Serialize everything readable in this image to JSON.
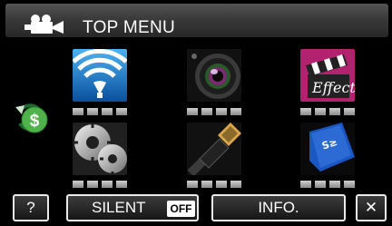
{
  "header": {
    "title": "TOP MENU",
    "mode_icon": "video-camera-icon"
  },
  "menu_tiles": [
    {
      "name": "wireless",
      "icon": "wifi-icon"
    },
    {
      "name": "lens",
      "icon": "camera-lens-icon"
    },
    {
      "name": "effect",
      "icon": "effect-clapper-icon"
    },
    {
      "name": "setup",
      "icon": "gears-icon"
    },
    {
      "name": "connection",
      "icon": "hdmi-cable-icon"
    },
    {
      "name": "media",
      "icon": "sd-card-icon"
    }
  ],
  "side_button": {
    "icon": "dollar-refresh-icon",
    "glyph": "$"
  },
  "bottom_bar": {
    "help_label": "?",
    "silent_label": "SILENT",
    "silent_state": "OFF",
    "info_label": "INFO.",
    "close_label": "✕"
  },
  "colors": {
    "wifi_tile": "#1c7fd0",
    "effect_tile": "#b3226e",
    "sd_tile": "#1a56c4",
    "button_border": "#eaeaea",
    "dollar_green": "#4fb24a"
  }
}
